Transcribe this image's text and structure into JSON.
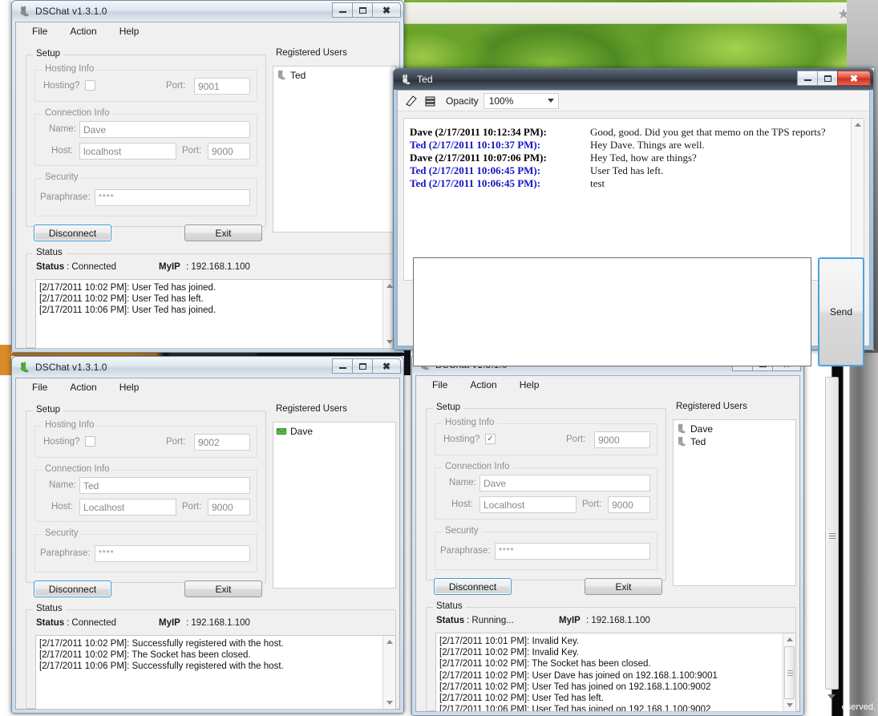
{
  "background": {
    "browser_star_icon": "★",
    "footer_text": "eserved.",
    "moss_alt": "green moss landscape photo"
  },
  "windows": {
    "client_dave": {
      "title": "DSChat v1.3.1.0",
      "icon": "bunny-icon",
      "menu": [
        "File",
        "Action",
        "Help"
      ],
      "setup_legend": "Setup",
      "hosting_legend": "Hosting Info",
      "hosting_label": "Hosting?",
      "hosting_checked": "",
      "hosting_port_label": "Port:",
      "hosting_port_value": "9001",
      "connection_legend": "Connection Info",
      "name_label": "Name:",
      "name_value": "Dave",
      "host_label": "Host:",
      "host_value": "localhost",
      "conn_port_label": "Port:",
      "conn_port_value": "9000",
      "security_legend": "Security",
      "paraphrase_label": "Paraphrase:",
      "paraphrase_value": "****",
      "disconnect_label": "Disconnect",
      "exit_label": "Exit",
      "users_legend": "Registered Users",
      "users": [
        {
          "name": "Ted",
          "icon": "bunny-icon"
        }
      ],
      "status_legend": "Status",
      "status_key": "Status",
      "status_value": ": Connected",
      "myip_key": "MyIP",
      "myip_value": ":  192.168.1.100",
      "log": [
        "[2/17/2011 10:02 PM]: User Ted has joined.",
        "[2/17/2011 10:02 PM]: User Ted has left.",
        "[2/17/2011 10:06 PM]: User Ted has joined."
      ]
    },
    "chat": {
      "title": "Ted",
      "icon": "bunny-icon",
      "toolbar": {
        "clear_icon": "eraser-icon",
        "save_icon": "save-stack-icon",
        "opacity_label": "Opacity",
        "opacity_value": "100%"
      },
      "messages": [
        {
          "who": "Dave (2/17/2011 10:12:34 PM):",
          "side": "me",
          "msg": "Good, good. Did you get that memo on the TPS reports?"
        },
        {
          "who": "Ted (2/17/2011 10:10:37 PM):",
          "side": "them",
          "msg": "Hey Dave. Things are well."
        },
        {
          "who": "Dave (2/17/2011 10:07:06 PM):",
          "side": "me",
          "msg": "Hey Ted, how are things?"
        },
        {
          "who": "Ted (2/17/2011 10:06:45 PM):",
          "side": "them",
          "msg": "User Ted has left."
        },
        {
          "who": "Ted (2/17/2011 10:06:45 PM):",
          "side": "them",
          "msg": "test"
        }
      ],
      "input_value": "",
      "send_label": "Send"
    },
    "client_ted": {
      "title": "DSChat v1.3.1.0",
      "icon": "bunny-green-icon",
      "menu": [
        "File",
        "Action",
        "Help"
      ],
      "setup_legend": "Setup",
      "hosting_legend": "Hosting Info",
      "hosting_label": "Hosting?",
      "hosting_checked": "",
      "hosting_port_label": "Port:",
      "hosting_port_value": "9002",
      "connection_legend": "Connection Info",
      "name_label": "Name:",
      "name_value": "Ted",
      "host_label": "Host:",
      "host_value": "Localhost",
      "conn_port_label": "Port:",
      "conn_port_value": "9000",
      "security_legend": "Security",
      "paraphrase_label": "Paraphrase:",
      "paraphrase_value": "****",
      "disconnect_label": "Disconnect",
      "exit_label": "Exit",
      "users_legend": "Registered Users",
      "users": [
        {
          "name": "Dave",
          "icon": "green-envelope-icon"
        }
      ],
      "status_legend": "Status",
      "status_key": "Status",
      "status_value": ": Connected",
      "myip_key": "MyIP",
      "myip_value": ":  192.168.1.100",
      "log": [
        "[2/17/2011 10:02 PM]: Successfully registered with the host.",
        "[2/17/2011 10:02 PM]: The Socket has been closed.",
        "[2/17/2011 10:06 PM]: Successfully registered with the host."
      ]
    },
    "server_dave": {
      "title": "DSChat v1.3.1.0",
      "icon": "bunny-icon",
      "menu": [
        "File",
        "Action",
        "Help"
      ],
      "setup_legend": "Setup",
      "hosting_legend": "Hosting Info",
      "hosting_label": "Hosting?",
      "hosting_checked": "✓",
      "hosting_port_label": "Port:",
      "hosting_port_value": "9000",
      "connection_legend": "Connection Info",
      "name_label": "Name:",
      "name_value": "Dave",
      "host_label": "Host:",
      "host_value": "Localhost",
      "conn_port_label": "Port:",
      "conn_port_value": "9000",
      "security_legend": "Security",
      "paraphrase_label": "Paraphrase:",
      "paraphrase_value": "****",
      "disconnect_label": "Disconnect",
      "exit_label": "Exit",
      "users_legend": "Registered Users",
      "users": [
        {
          "name": "Dave",
          "icon": "bunny-icon"
        },
        {
          "name": "Ted",
          "icon": "bunny-icon"
        }
      ],
      "status_legend": "Status",
      "status_key": "Status",
      "status_value": ": Running...",
      "myip_key": "MyIP",
      "myip_value": ":  192.168.1.100",
      "log": [
        "[2/17/2011 10:01 PM]: Invalid Key.",
        "[2/17/2011 10:02 PM]: Invalid Key.",
        "[2/17/2011 10:02 PM]: The Socket has been closed.",
        "[2/17/2011 10:02 PM]: User Dave has joined on 192.168.1.100:9001",
        "[2/17/2011 10:02 PM]: User Ted has joined on 192.168.1.100:9002",
        "[2/17/2011 10:02 PM]: User Ted has left.",
        "[2/17/2011 10:06 PM]: User Ted has joined on 192.168.1.100:9002"
      ]
    }
  }
}
